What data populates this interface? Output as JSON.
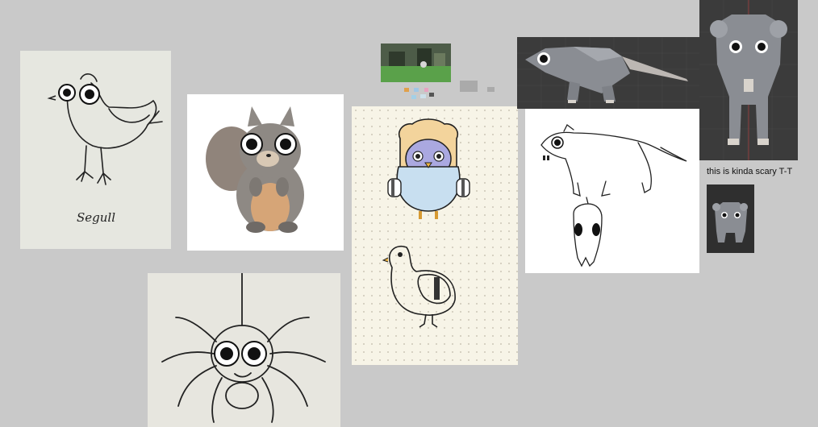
{
  "canvas": {
    "background": "#c9c9c9"
  },
  "cards": {
    "seagull": {
      "label": "Segull",
      "icon": "seagull-drawing"
    },
    "squirrel": {
      "icon": "squirrel-drawing"
    },
    "spider": {
      "icon": "spider-drawing"
    },
    "pigeons": {
      "icon": "pigeon-drawings"
    },
    "game_thumbnail": {
      "icon": "game-screenshot"
    },
    "rat_model_side": {
      "icon": "rat-3d-side"
    },
    "rat_model_front": {
      "icon": "rat-3d-front"
    },
    "rat_sketch": {
      "icon": "rat-sketch"
    },
    "rat_model_small": {
      "icon": "rat-3d-small"
    }
  },
  "caption": "this is kinda scary T-T",
  "colors": {
    "pigeon_body": "#c8dff0",
    "pigeon_toast": "#f3d49c",
    "pigeon_head": "#aaa8e0",
    "squirrel_body": "#8a8580",
    "squirrel_belly": "#d6a577"
  }
}
